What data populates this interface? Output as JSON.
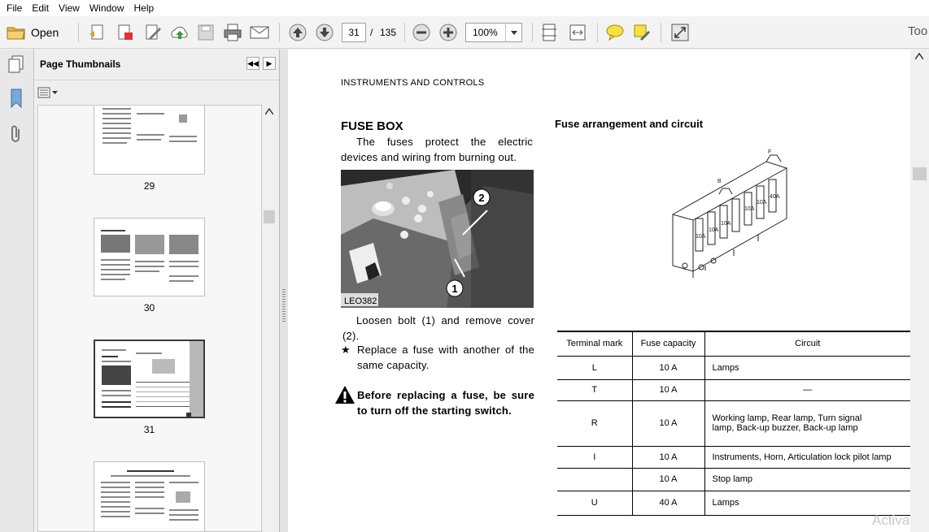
{
  "menu": [
    "File",
    "Edit",
    "View",
    "Window",
    "Help"
  ],
  "toolbar": {
    "open_label": "Open",
    "page_current": "31",
    "page_separator": "/",
    "page_total": "135",
    "zoom": "100%",
    "tools_label": "Too",
    "icons": [
      "folder-icon",
      "create-pdf-icon",
      "export-icon",
      "edit-icon",
      "upload-icon",
      "save-icon",
      "print-icon",
      "email-icon",
      "page-up-icon",
      "page-down-icon",
      "zoom-out-icon",
      "zoom-in-icon",
      "fit-page-icon",
      "fit-width-icon",
      "comment-icon",
      "highlight-icon",
      "full-screen-icon"
    ]
  },
  "sidebar": {
    "title": "Page Thumbnails",
    "pages": [
      {
        "num": "29"
      },
      {
        "num": "30"
      },
      {
        "num": "31",
        "selected": true
      },
      {
        "num": ""
      }
    ]
  },
  "document": {
    "header": "INSTRUMENTS AND CONTROLS",
    "fuse_title": "FUSE BOX",
    "intro": "The fuses protect the electric devices and wiring from burning out.",
    "photo_code": "LEO382",
    "photo_label_1": "1",
    "photo_label_2": "2",
    "step1": "Loosen bolt (1) and remove cover (2).",
    "step2_marker": "★",
    "step2": "Replace a fuse with another of the same capacity.",
    "warning": "Before replacing a fuse, be sure to turn off the starting switch.",
    "arrangement_title": "Fuse arrangement and circuit",
    "diagram_labels": [
      "F",
      "B",
      "40A",
      "10A",
      "10A",
      "10A",
      "10A",
      "10A"
    ],
    "table": {
      "headers": [
        "Terminal mark",
        "Fuse capacity",
        "Circuit"
      ],
      "rows": [
        [
          "L",
          "10 A",
          "Lamps"
        ],
        [
          "T",
          "10 A",
          "—"
        ],
        [
          "R",
          "10 A",
          "Working lamp, Rear lamp, Turn signal lamp, Back-up buzzer, Back-up lamp"
        ],
        [
          "I",
          "10 A",
          "Instruments, Horn, Articulation lock pilot lamp"
        ],
        [
          "",
          "10 A",
          "Stop lamp"
        ],
        [
          "U",
          "40 A",
          "Lamps"
        ]
      ]
    },
    "watermark": "Activat"
  }
}
